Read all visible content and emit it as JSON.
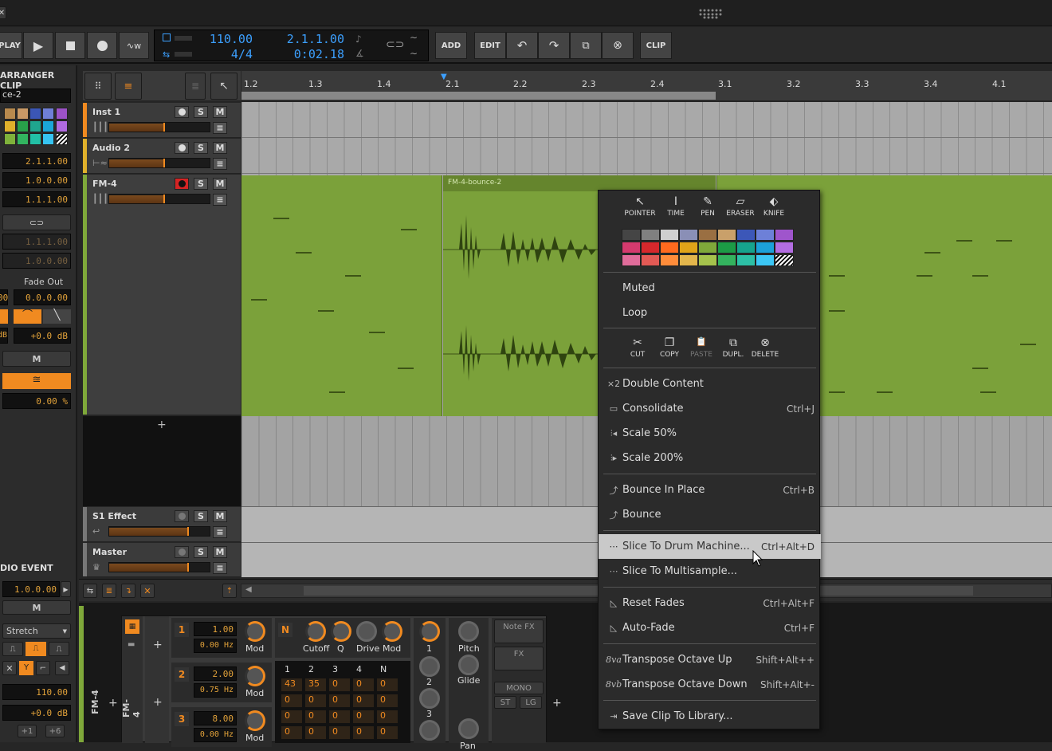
{
  "titlebar": {
    "close_glyph": "✕",
    "logo": "bitwig-logo-icon"
  },
  "transport": {
    "play_label": "PLAY",
    "tempo": "110.00",
    "signature": "4/4",
    "position": "2.1.1.00",
    "time": "0:02.18",
    "add_label": "ADD",
    "edit_label": "EDIT",
    "clip_label": "CLIP"
  },
  "inspector": {
    "section_title": "ARRANGER CLIP",
    "clip_name": "ce-2",
    "pos1": "2.1.1.00",
    "pos2": "1.0.0.00",
    "pos3": "1.1.1.00",
    "pos4": "1.1.1.00",
    "pos5": "1.0.0.00",
    "fade_label": "Fade Out",
    "fade_left": "00",
    "fade_val": "0.0.0.00",
    "gain_left": "dB",
    "gain_val": "+0.0 dB",
    "mute_label": "M",
    "pct": "0.00 %",
    "event_title": "DIO EVENT",
    "event_pos": "1.0.0.00",
    "event_mute": "M",
    "stretch": "Stretch",
    "tempo_val": "110.00",
    "event_gain": "+0.0 dB",
    "semi1": "+1",
    "semi2": "+6",
    "swatches": [
      "#b88a4e",
      "#c99a66",
      "#3b56b6",
      "#6f7fd6",
      "#9c52c7",
      "#e0b02b",
      "#28a04a",
      "#1fa58e",
      "#1ba6d8",
      "#b06ae0",
      "#7fb23b",
      "#32b45f",
      "#22c0a6",
      "#36c4f2"
    ]
  },
  "ruler": {
    "marks": [
      "1.2",
      "1.3",
      "1.4",
      "2.1",
      "2.2",
      "2.3",
      "2.4",
      "3.1",
      "3.2",
      "3.3",
      "3.4",
      "4.1"
    ]
  },
  "tracks": [
    {
      "name": "Inst 1",
      "color": "#f08a20",
      "rec": false
    },
    {
      "name": "Audio 2",
      "color": "#e0b02b",
      "rec": false
    },
    {
      "name": "FM-4",
      "color": "#7fa83a",
      "rec": true
    },
    {
      "name": "S1 Effect",
      "color": "#777777",
      "rec": false
    },
    {
      "name": "Master",
      "color": "#777777",
      "rec": false
    }
  ],
  "track_buttons": {
    "solo": "S",
    "mute": "M"
  },
  "clip": {
    "name": "FM-4-bounce-2"
  },
  "add_track_glyph": "+",
  "context_menu": {
    "tools": [
      {
        "label": "POINTER",
        "glyph": "↖"
      },
      {
        "label": "TIME",
        "glyph": "I"
      },
      {
        "label": "PEN",
        "glyph": "✎"
      },
      {
        "label": "ERASER",
        "glyph": "▱"
      },
      {
        "label": "KNIFE",
        "glyph": "⬖"
      }
    ],
    "colors": [
      "#454545",
      "#808080",
      "#cfcfcf",
      "#8a8fb6",
      "#9a6f42",
      "#c9a06a",
      "#3c57b8",
      "#6d80d8",
      "#9f55cc",
      "#d43a6e",
      "#d6282c",
      "#ff6a1e",
      "#e0a419",
      "#7fa83a",
      "#1c9b46",
      "#16a38d",
      "#1ca1d9",
      "#b36de2",
      "#e06c9a",
      "#e35a55",
      "#ff8c3a",
      "#e3b64c",
      "#a5c24c",
      "#34b35e",
      "#2dc0a6",
      "#3cc7f5",
      "pattern"
    ],
    "muted": "Muted",
    "loop": "Loop",
    "edit": [
      {
        "label": "CUT",
        "glyph": "✂"
      },
      {
        "label": "COPY",
        "glyph": "❐"
      },
      {
        "label": "PASTE",
        "glyph": "📋"
      },
      {
        "label": "DUPL.",
        "glyph": "⧉"
      },
      {
        "label": "DELETE",
        "glyph": "⊗"
      }
    ],
    "items": [
      {
        "label": "Double Content",
        "shortcut": "",
        "icon": "×2"
      },
      {
        "label": "Consolidate",
        "shortcut": "Ctrl+J",
        "icon": "▭"
      },
      {
        "label": "Scale 50%",
        "shortcut": "",
        "icon": "⫶◂"
      },
      {
        "label": "Scale 200%",
        "shortcut": "",
        "icon": "⫶▸"
      },
      {
        "label": "Bounce In Place",
        "shortcut": "Ctrl+B",
        "icon": "⤴"
      },
      {
        "label": "Bounce",
        "shortcut": "",
        "icon": "⤴"
      },
      {
        "label": "Slice To Drum Machine...",
        "shortcut": "Ctrl+Alt+D",
        "icon": "⋯"
      },
      {
        "label": "Slice To Multisample...",
        "shortcut": "",
        "icon": "⋯"
      },
      {
        "label": "Reset Fades",
        "shortcut": "Ctrl+Alt+F",
        "icon": "◺"
      },
      {
        "label": "Auto-Fade",
        "shortcut": "Ctrl+F",
        "icon": "◺"
      },
      {
        "label": "Transpose Octave Up",
        "shortcut": "Shift+Alt++",
        "icon": "8va"
      },
      {
        "label": "Transpose Octave Down",
        "shortcut": "Shift+Alt+-",
        "icon": "8vb"
      },
      {
        "label": "Save Clip To Library...",
        "shortcut": "",
        "icon": "⇥"
      }
    ]
  },
  "device": {
    "track_label": "FM-4",
    "device_label": "FM-4",
    "ops": [
      {
        "num": "1",
        "ratio": "1.00",
        "hz": "0.00 Hz",
        "mod": "Mod"
      },
      {
        "num": "2",
        "ratio": "2.00",
        "hz": "0.75 Hz",
        "mod": "Mod"
      },
      {
        "num": "3",
        "ratio": "8.00",
        "hz": "0.00 Hz",
        "mod": "Mod"
      }
    ],
    "n_label": "N",
    "knobs": [
      "Cutoff",
      "Q",
      "Drive",
      "Mod"
    ],
    "matrix_head": [
      "1",
      "2",
      "3",
      "4",
      "N"
    ],
    "matrix": [
      [
        "43",
        "35",
        "0",
        "0",
        "0"
      ],
      [
        "0",
        "0",
        "0",
        "0",
        "0"
      ],
      [
        "0",
        "0",
        "0",
        "0",
        "0"
      ],
      [
        "0",
        "0",
        "0",
        "0",
        "0"
      ]
    ],
    "col_knobs": [
      "1",
      "2",
      "3"
    ],
    "pitch": "Pitch",
    "glide": "Glide",
    "note_fx": "Note FX",
    "fx": "FX",
    "mono": "MONO",
    "st": "ST",
    "lg": "LG",
    "pan": "Pan"
  }
}
